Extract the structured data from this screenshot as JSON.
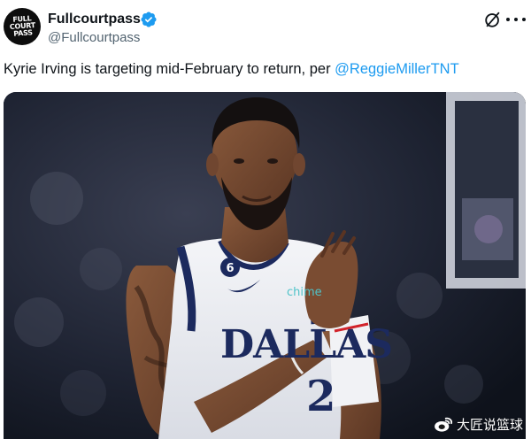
{
  "author": {
    "display_name": "Fullcourtpass",
    "handle": "@Fullcourtpass",
    "avatar_logo_text": "FULL\nCOURT\nPASS",
    "verified": true
  },
  "header_actions": {
    "grok_icon": "grok-slash-circle-icon",
    "more_icon": "more-horizontal-icon"
  },
  "tweet": {
    "text": "Kyrie Irving is targeting mid-February to return, per ",
    "mention": "@ReggieMillerTNT"
  },
  "media": {
    "jersey_text": "DALLAS",
    "jersey_number": "2",
    "collar_number": "6",
    "sponsor_text": "chime"
  },
  "watermark": {
    "text": "大匠说篮球",
    "icon": "weibo-icon"
  },
  "colors": {
    "text_primary": "#0f1419",
    "text_secondary": "#536471",
    "link": "#1d9bf0",
    "verified_badge": "#1d9bf0",
    "jersey_navy": "#1c2a5e"
  }
}
